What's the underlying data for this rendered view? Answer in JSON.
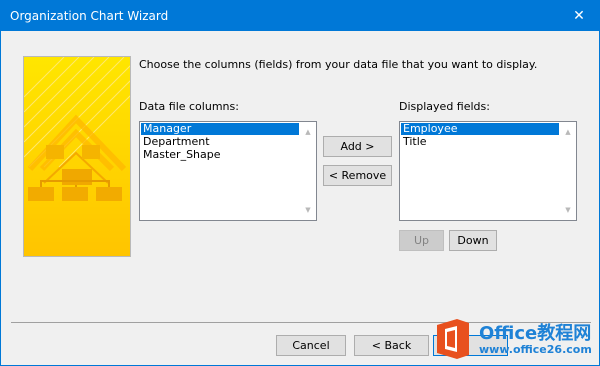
{
  "window": {
    "title": "Organization Chart Wizard",
    "close_glyph": "✕"
  },
  "instruction": "Choose the columns (fields) from your data file that you want to display.",
  "left_list": {
    "label": "Data file columns:",
    "items": [
      {
        "text": "Manager",
        "selected": true
      },
      {
        "text": "Department",
        "selected": false
      },
      {
        "text": "Master_Shape",
        "selected": false
      }
    ]
  },
  "right_list": {
    "label": "Displayed fields:",
    "items": [
      {
        "text": "Employee",
        "selected": true
      },
      {
        "text": "Title",
        "selected": false
      }
    ]
  },
  "buttons": {
    "add": "Add >",
    "remove": "< Remove",
    "up": "Up",
    "down": "Down",
    "cancel": "Cancel",
    "back": "< Back"
  },
  "watermark": {
    "name": "Office教程网",
    "url": "www.office26.com"
  },
  "colors": {
    "accent": "#0078d7",
    "wizard_yellow": "#ffd400",
    "watermark_orange": "#e8501e"
  },
  "icons": {
    "close": "close-icon",
    "scroll_up": "scroll-up-arrow-icon",
    "scroll_down": "scroll-down-arrow-icon",
    "office_logo": "office-logo-icon"
  }
}
